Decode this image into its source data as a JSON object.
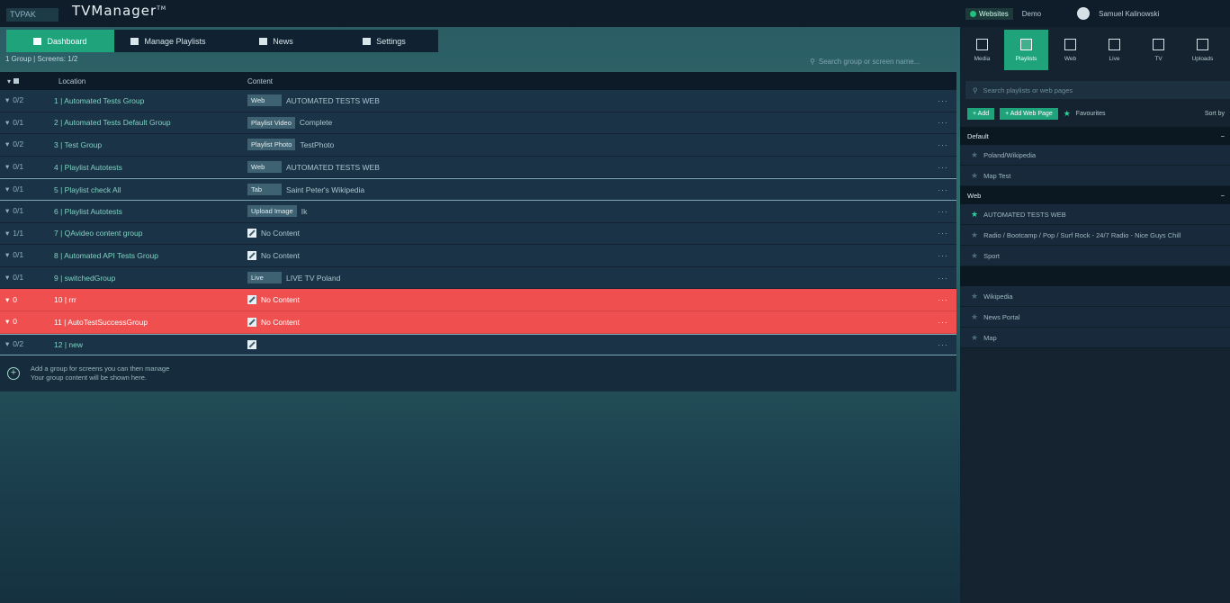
{
  "app": {
    "badge": "TVPAK",
    "name": "TVManager",
    "name_super": "TM"
  },
  "nav": {
    "tabs": [
      {
        "label": "Dashboard",
        "active": true
      },
      {
        "label": "Manage Playlists",
        "active": false
      },
      {
        "label": "News",
        "active": false
      },
      {
        "label": "Settings",
        "active": false
      }
    ]
  },
  "subtitle": "1 Group | Screens: 1/2",
  "search": {
    "placeholder": "Search group or screen name..."
  },
  "table": {
    "headers": {
      "name": "Location",
      "content": "Content"
    },
    "rows": [
      {
        "status": "0/2",
        "name": "1 | Automated Tests Group",
        "chip": "Web",
        "content": "AUTOMATED TESTS WEB",
        "error": false,
        "selected": false
      },
      {
        "status": "0/1",
        "name": "2 | Automated Tests Default Group",
        "chip": "Playlist Video",
        "content": "Complete",
        "error": false,
        "selected": false
      },
      {
        "status": "0/2",
        "name": "3 | Test Group",
        "chip": "Playlist Photo",
        "content": "TestPhoto",
        "error": false,
        "selected": false
      },
      {
        "status": "0/1",
        "name": "4 | Playlist Autotests",
        "chip": "Web",
        "content": "AUTOMATED TESTS WEB",
        "error": false,
        "selected": false
      },
      {
        "status": "0/1",
        "name": "5 | Playlist check All",
        "chip": "Tab",
        "content": "Saint Peter's Wikipedia",
        "error": false,
        "selected": true
      },
      {
        "status": "0/1",
        "name": "6 | Playlist Autotests",
        "chip": "Upload Image",
        "content": "Ik",
        "error": false,
        "selected": false
      },
      {
        "status": "1/1",
        "name": "7 | QAvideo content group",
        "chip": "",
        "content": "No Content",
        "error": false,
        "selected": false
      },
      {
        "status": "0/1",
        "name": "8 | Automated API Tests Group",
        "chip": "",
        "content": "No Content",
        "error": false,
        "selected": false
      },
      {
        "status": "0/1",
        "name": "9 | switchedGroup",
        "chip": "Live",
        "content": "LIVE TV Poland",
        "error": false,
        "selected": false
      },
      {
        "status": "0",
        "name": "10 | rrr",
        "chip": "",
        "content": "No Content",
        "error": true,
        "selected": false
      },
      {
        "status": "0",
        "name": "11 | AutoTestSuccessGroup",
        "chip": "",
        "content": "No Content",
        "error": true,
        "selected": false
      },
      {
        "status": "0/2",
        "name": "12 | new",
        "chip": "",
        "content": "",
        "error": false,
        "selected": true
      }
    ],
    "more_label": "···"
  },
  "add_group": {
    "line1": "Add a group for screens you can then manage",
    "line2": "Your group content will be shown here."
  },
  "panel": {
    "online_label": "Websites",
    "account_label": "Demo",
    "user_name": "Samuel Kalinowski",
    "tabs": [
      {
        "label": "Media",
        "active": false
      },
      {
        "label": "Playlists",
        "active": true
      },
      {
        "label": "Web",
        "active": false
      },
      {
        "label": "Live",
        "active": false
      },
      {
        "label": "TV",
        "active": false
      },
      {
        "label": "Uploads",
        "active": false
      }
    ],
    "search_placeholder": "Search playlists or web pages",
    "btn_add": "+ Add",
    "btn_add_web": "+ Add Web Page",
    "favorites_label": "Favourites",
    "sort_label": "Sort by",
    "sections": [
      {
        "title": "Default",
        "items": [
          {
            "label": "Poland/Wikipedia",
            "fav": false
          },
          {
            "label": "Map Test",
            "fav": false
          }
        ]
      },
      {
        "title": "Web",
        "items": [
          {
            "label": "AUTOMATED TESTS WEB",
            "fav": true
          },
          {
            "label": "Radio / Bootcamp / Pop / Surf Rock - 24/7 Radio - Nice Guys Chill",
            "fav": false
          },
          {
            "label": "Sport",
            "fav": false
          }
        ]
      }
    ],
    "extra_items": [
      {
        "label": "Wikipedia",
        "fav": false
      },
      {
        "label": "News Portal",
        "fav": false
      },
      {
        "label": "Map",
        "fav": false
      }
    ]
  }
}
